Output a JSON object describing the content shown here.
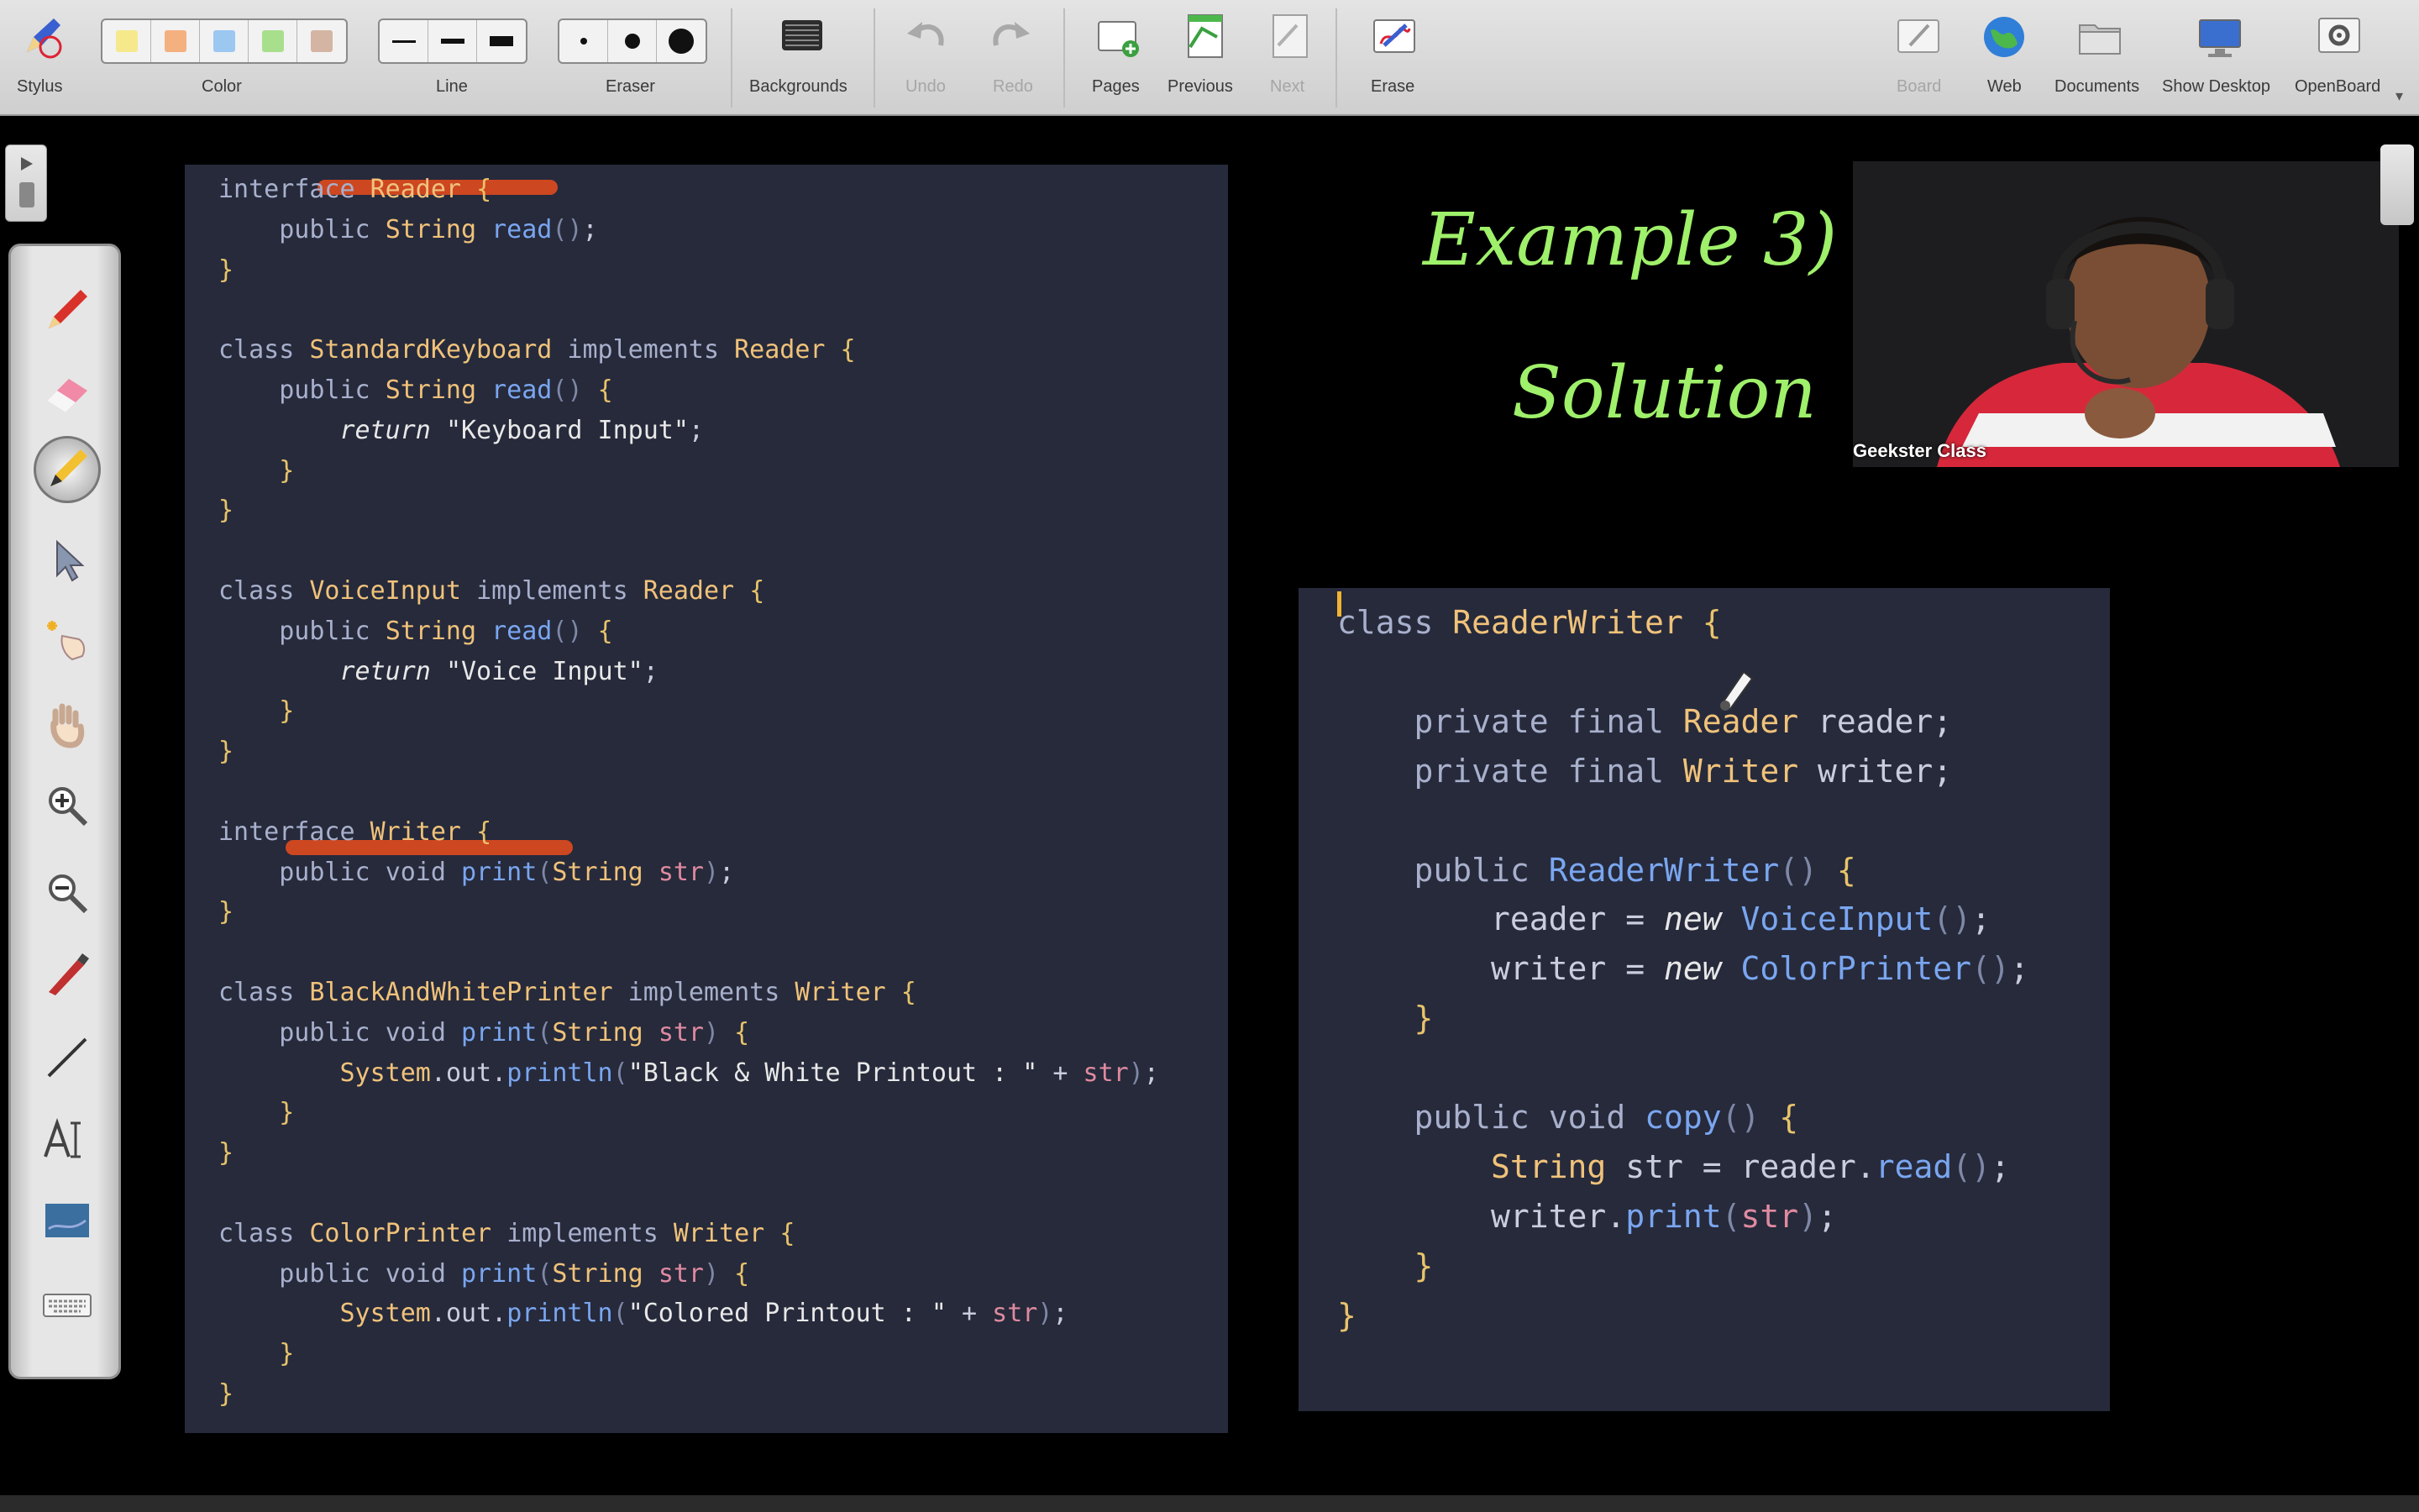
{
  "toolbar": {
    "stylus": "Stylus",
    "color": "Color",
    "line": "Line",
    "eraser": "Eraser",
    "backgrounds": "Backgrounds",
    "undo": "Undo",
    "redo": "Redo",
    "pages": "Pages",
    "previous": "Previous",
    "next": "Next",
    "erase": "Erase",
    "board": "Board",
    "web": "Web",
    "documents": "Documents",
    "show_desktop": "Show Desktop",
    "openboard": "OpenBoard",
    "swatches": [
      "#f5e66a",
      "#f59a5a",
      "#7fb8f0",
      "#8fd86a",
      "#c9a08a"
    ],
    "disabled": [
      "Undo",
      "Redo",
      "Next",
      "Board"
    ]
  },
  "left_palette": {
    "tools": [
      "pen-icon",
      "eraser-icon",
      "marker-icon",
      "selector-icon",
      "laser-pointer-icon",
      "hand-icon",
      "zoom-in-icon",
      "zoom-out-icon",
      "line-pen-icon",
      "line-icon",
      "text-icon",
      "capture-icon",
      "keyboard-icon"
    ],
    "active_tool": "marker-icon"
  },
  "code_left": [
    "interface Reader {",
    "    public String read();",
    "}",
    "",
    "class StandardKeyboard implements Reader {",
    "    public String read() {",
    "        return \"Keyboard Input\";",
    "    }",
    "}",
    "",
    "class VoiceInput implements Reader {",
    "    public String read() {",
    "        return \"Voice Input\";",
    "    }",
    "}",
    "",
    "interface Writer {",
    "    public void print(String str);",
    "}",
    "",
    "class BlackAndWhitePrinter implements Writer {",
    "    public void print(String str) {",
    "        System.out.println(\"Black & White Printout : \" + str);",
    "    }",
    "}",
    "",
    "class ColorPrinter implements Writer {",
    "    public void print(String str) {",
    "        System.out.println(\"Colored Printout : \" + str);",
    "    }",
    "}"
  ],
  "code_right": [
    "class ReaderWriter {",
    "",
    "    private final Reader reader;",
    "    private final Writer writer;",
    "",
    "    public ReaderWriter() {",
    "        reader = new VoiceInput();",
    "        writer = new ColorPrinter();",
    "    }",
    "",
    "    public void copy() {",
    "        String str = reader.read();",
    "        writer.print(str);",
    "    }",
    "}"
  ],
  "handwriting": {
    "line1": "Example 3)",
    "line2": "Solution",
    "color": "#9ff06a"
  },
  "webcam": {
    "label": "Geekster Class"
  },
  "colors": {
    "code_bg": "#262a3b",
    "highlight": "#e04a1f",
    "caret": "#f2b233"
  }
}
